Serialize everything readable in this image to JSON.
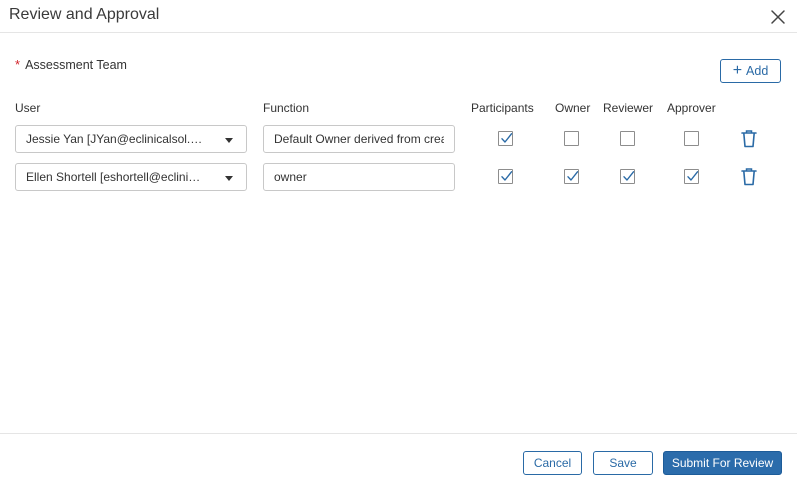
{
  "dialog": {
    "title": "Review and Approval"
  },
  "team": {
    "required_marker": "*",
    "label": "Assessment Team",
    "add_label": "Add"
  },
  "columns": {
    "user": "User",
    "function": "Function",
    "participants": "Participants",
    "owner": "Owner",
    "reviewer": "Reviewer",
    "approver": "Approver"
  },
  "rows": [
    {
      "user": "Jessie Yan [JYan@eclinicalsol.com]",
      "function": "Default Owner derived from creator",
      "participants": true,
      "owner": false,
      "reviewer": false,
      "approver": false
    },
    {
      "user": "Ellen Shortell [eshortell@eclinicalsol.com]",
      "function": "owner",
      "participants": true,
      "owner": true,
      "reviewer": true,
      "approver": true
    }
  ],
  "footer": {
    "cancel_label": "Cancel",
    "save_label": "Save",
    "submit_label": "Submit For Review"
  },
  "colors": {
    "accent": "#2a6aa6",
    "primary_button": "#2b6cab",
    "required": "#d2232a"
  }
}
